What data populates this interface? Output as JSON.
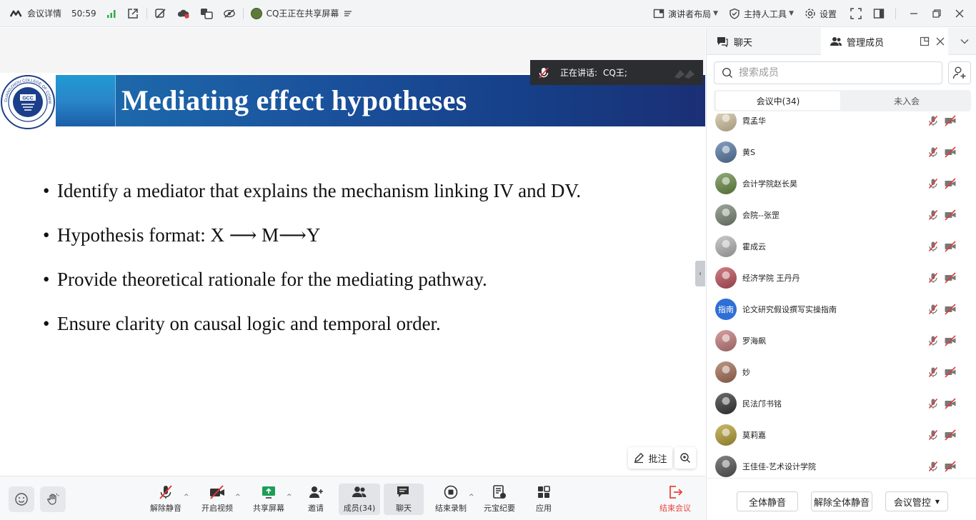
{
  "titlebar": {
    "meeting_details": "会议详情",
    "timer": "50:59",
    "sharing_status": "CQ王正在共享屏幕",
    "presenter_layout": "演讲者布局",
    "host_tools": "主持人工具",
    "settings": "设置"
  },
  "slide": {
    "title": "Mediating effect hypotheses",
    "bullets": [
      "Identify a mediator that explains the mechanism linking IV and DV.",
      "Hypothesis format: X ⟶ M⟶Y",
      "Provide theoretical rationale for the mediating pathway.",
      "Ensure clarity on causal logic and temporal order."
    ],
    "logo_text_arc": "GUANGZHOU COLLEGE OF COMMERCE",
    "logo_center": "GCC"
  },
  "speaking": {
    "label": "正在讲话:",
    "name": "CQ王;"
  },
  "stage_tools": {
    "annotate": "批注"
  },
  "toolbar": {
    "unmute": "解除静音",
    "start_video": "开启视频",
    "share_screen": "共享屏幕",
    "invite": "邀请",
    "members": "成员(34)",
    "chat": "聊天",
    "end_record": "结束录制",
    "yuanbao": "元宝纪要",
    "apps": "应用",
    "end_meeting": "结束会议"
  },
  "panel": {
    "tab_chat": "聊天",
    "tab_members": "管理成员",
    "search_placeholder": "搜索成员",
    "seg_in_meeting": "会议中(34)",
    "seg_not_joined": "未入会",
    "members": [
      {
        "name": "霓孟华",
        "avatar_color": "#d9c9a6"
      },
      {
        "name": "黄S",
        "avatar_color": "#5b7ea8"
      },
      {
        "name": "会计学院赵长昊",
        "avatar_color": "#6d8f4a"
      },
      {
        "name": "会院--张罡",
        "avatar_color": "#7d8a78"
      },
      {
        "name": "霍成云",
        "avatar_color": "#b9b9b9"
      },
      {
        "name": "经济学院 王丹丹",
        "avatar_color": "#c2545e"
      },
      {
        "name": "论文研究假设撰写实操指南",
        "avatar_color": "#2e6fd6",
        "avatar_text": "指南"
      },
      {
        "name": "罗海飙",
        "avatar_color": "#c98080"
      },
      {
        "name": "妙",
        "avatar_color": "#a8735a"
      },
      {
        "name": "民法邝书铭",
        "avatar_color": "#3a3a3a"
      },
      {
        "name": "莫莉嘉",
        "avatar_color": "#b8a23a"
      },
      {
        "name": "王佳佳-艺术设计学院",
        "avatar_color": "#5a5a5a"
      }
    ],
    "mute_all": "全体静音",
    "unmute_all": "解除全体静音",
    "meeting_control": "会议管控"
  },
  "colors": {
    "banner_dark": "#163e86",
    "banner_light": "#1f9ad1",
    "mute_red": "#e03a3a",
    "end_red": "#e8443a",
    "avatar_blue": "#2e6fd6"
  }
}
